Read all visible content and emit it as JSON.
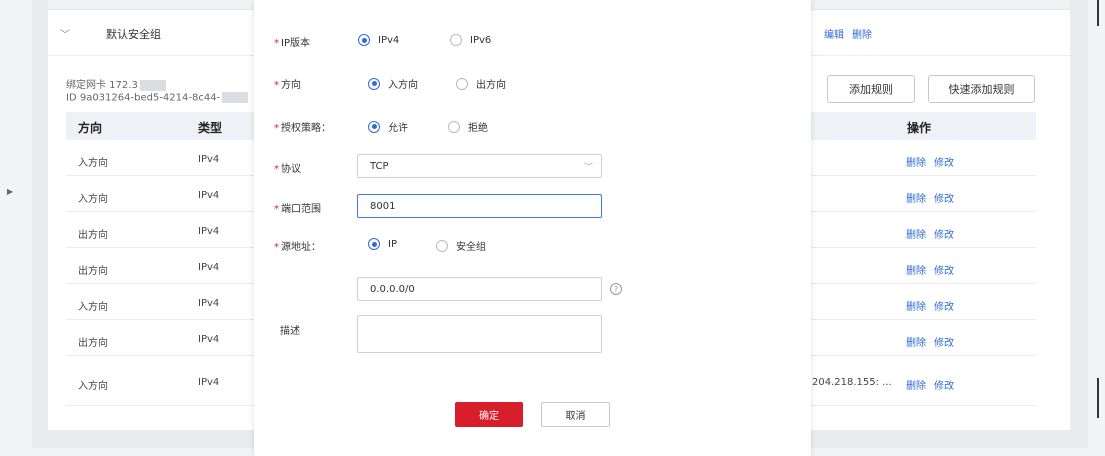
{
  "background": {
    "group_title": "默认安全组",
    "header_actions": [
      "编辑",
      "删除"
    ],
    "bind_nic_label": "绑定网卡 172.3",
    "bind_id_label": "ID 9a031264-bed5-4214-8c44-",
    "buttons": {
      "add_rule": "添加规则",
      "quick_add_rule": "快速添加规则"
    },
    "table": {
      "headers": {
        "direction": "方向",
        "type": "类型",
        "ops": "操作"
      },
      "rows": [
        {
          "direction": "入方向",
          "type": "IPv4",
          "extra": ""
        },
        {
          "direction": "入方向",
          "type": "IPv4",
          "extra": ""
        },
        {
          "direction": "出方向",
          "type": "IPv4",
          "extra": ""
        },
        {
          "direction": "出方向",
          "type": "IPv4",
          "extra": ""
        },
        {
          "direction": "入方向",
          "type": "IPv4",
          "extra": ""
        },
        {
          "direction": "出方向",
          "type": "IPv4",
          "extra": ""
        },
        {
          "direction": "入方向",
          "type": "IPv4",
          "extra": "204.218.155: ..."
        }
      ],
      "row_actions": {
        "delete": "删除",
        "edit": "修改"
      }
    }
  },
  "modal": {
    "ip_version": {
      "label": "IP版本",
      "options": [
        "IPv4",
        "IPv6"
      ],
      "selected": "IPv4"
    },
    "direction": {
      "label": "方向",
      "options": [
        "入方向",
        "出方向"
      ],
      "selected": "入方向"
    },
    "policy": {
      "label": "授权策略：",
      "options": [
        "允许",
        "拒绝"
      ],
      "selected": "允许"
    },
    "protocol": {
      "label": "协议",
      "value": "TCP"
    },
    "port_range": {
      "label": "端口范围",
      "value": "8001"
    },
    "source": {
      "label": "源地址：",
      "options": [
        "IP",
        "安全组"
      ],
      "selected": "IP",
      "value": "0.0.0.0/0"
    },
    "description": {
      "label": "描述",
      "value": ""
    },
    "confirm": "确定",
    "cancel": "取消"
  },
  "colors": {
    "accent": "#2f6bd8",
    "primary_button": "#d81e2a",
    "required_star": "#e02020"
  }
}
